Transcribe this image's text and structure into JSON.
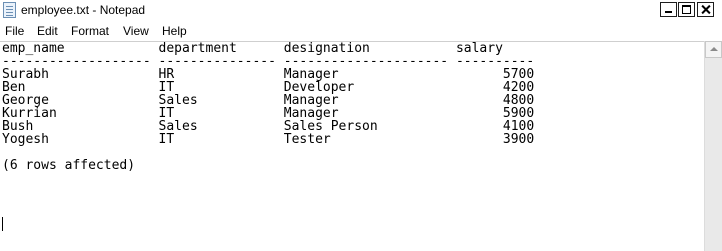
{
  "window": {
    "title": "employee.txt - Notepad",
    "icon": "notepad-icon"
  },
  "menu": {
    "file": "File",
    "edit": "Edit",
    "format": "Format",
    "view": "View",
    "help": "Help"
  },
  "document": {
    "header": "emp_name            department      designation           salary",
    "separator": "------------------- --------------- --------------------- ----------",
    "rows": [
      "Surabh              HR              Manager                     5700",
      "Ben                 IT              Developer                   4200",
      "George              Sales           Manager                     4800",
      "Kurrian             IT              Manager                     5900",
      "Bush                Sales           Sales Person                4100",
      "Yogesh              IT              Tester                      3900"
    ],
    "blank": "",
    "footer": "(6 rows affected)"
  }
}
